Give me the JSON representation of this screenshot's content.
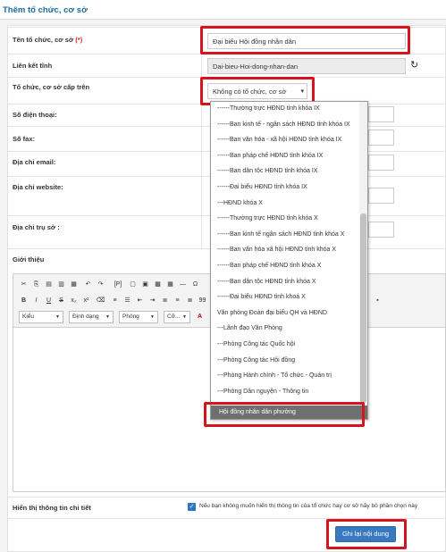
{
  "header": {
    "title": "Thêm tổ chức, cơ sở"
  },
  "form": {
    "name_label": "Tên tổ chức, cơ sở",
    "name_required": "(*)",
    "name_value": "Đại biểu Hội đồng nhân dân",
    "link_label": "Liên kết tĩnh",
    "link_value": "Dai-bieu-Hoi-dong-nhan-dan",
    "parent_label": "Tổ chức, cơ sở cấp trên",
    "parent_value": "Không có tổ chức, cơ sở",
    "phone_label": "Số điện thoại:",
    "fax_label": "Số fax:",
    "email_label": "Địa chỉ email:",
    "website_label": "Địa chỉ website:",
    "address_label": "Địa chỉ trụ sở :",
    "intro_label": "Giới thiệu",
    "detail_label": "Hiển thị thông tin chi tiết",
    "detail_checkbox_text": "Nếu bạn không muốn hiển thị thông tin của tổ chức hay cơ sở hãy bỏ phần chọn này",
    "detail_checked": true
  },
  "editor": {
    "combo_style": "Kiểu",
    "combo_format": "Định dạng",
    "combo_font": "Phông",
    "combo_size": "Cỡ...",
    "bold": "B",
    "italic": "I",
    "underline": "U",
    "strike": "S",
    "sub": "x₂",
    "sup": "x²",
    "source": "[P]",
    "quote": "99",
    "font_color": "A"
  },
  "dropdown": {
    "items": [
      "------Thường trực HĐND tỉnh khóa IX",
      "------Ban kinh tế - ngân sách HĐND tỉnh khóa IX",
      "------Ban văn hóa - xã hội HĐND tỉnh khóa IX",
      "------Ban pháp chế HĐND tỉnh khóa IX",
      "------Ban dân tộc HĐND tỉnh khóa IX",
      "------Đại biểu HĐND tỉnh khóa IX",
      "---HĐND khóa X",
      "------Thường trực HĐND tỉnh khóa X",
      "------Ban kinh tế ngân sách HĐND tỉnh khóa X",
      "------Ban văn hóa xã hội HĐND tỉnh khóa X",
      "------Ban pháp chế HĐND tỉnh khóa X",
      "------Ban dân tộc HĐND tỉnh khóa X",
      "------Đại biểu HĐND tỉnh khoá X",
      "Văn phòng Đoàn đại biểu QH và HĐND",
      "---Lãnh đạo Văn Phòng",
      "---Phòng Công tác Quốc hội",
      "---Phòng Công tác Hội đồng",
      "---Phòng Hành chính - Tổ chức - Quản trị",
      "---Phòng Dân nguyện - Thông tin"
    ],
    "selected": "Hội đồng nhân dân phường"
  },
  "buttons": {
    "save": "Ghi lại nội dung"
  },
  "colors": {
    "accent": "#3879c0",
    "highlight": "#d4141e",
    "title": "#1e6d9a"
  }
}
